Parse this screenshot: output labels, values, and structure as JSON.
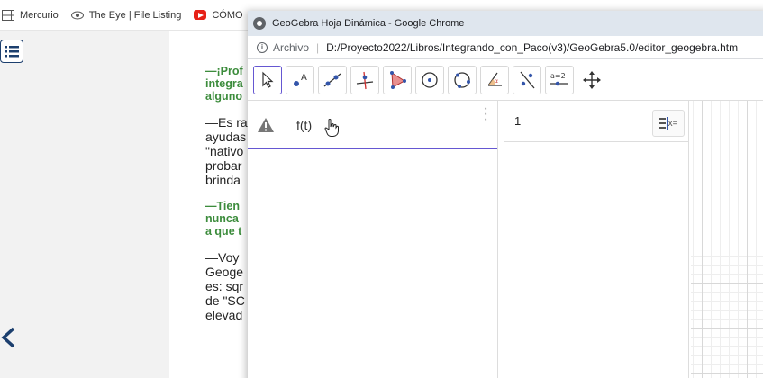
{
  "bookmarks": [
    {
      "label": "Mercurio",
      "icon": "film-icon"
    },
    {
      "label": "The Eye | File Listing",
      "icon": "eye-icon"
    },
    {
      "label": "CÓMO",
      "icon": "youtube-icon"
    }
  ],
  "background_page": {
    "paragraphs": [
      {
        "style": "green",
        "lines": [
          "—¡Prof",
          "integra",
          "alguno"
        ]
      },
      {
        "style": "normal",
        "lines": [
          "—Es ra",
          "ayudas",
          "\"nativo",
          "probar",
          "brinda"
        ]
      },
      {
        "style": "green",
        "lines": [
          "—Tien",
          "nunca ",
          "a que t"
        ]
      },
      {
        "style": "normal",
        "lines": [
          "—Voy ",
          "Geoge",
          "es: sqr",
          "de \"SC",
          "elevad"
        ]
      }
    ]
  },
  "window": {
    "title": "GeoGebra Hoja Dinámica - Google Chrome",
    "address": {
      "scheme": "Archivo",
      "url": "D:/Proyecto2022/Libros/Integrando_con_Paco(v3)/GeoGebra5.0/editor_geogebra.htm"
    }
  },
  "toolbar": {
    "tools": [
      {
        "name": "move-tool-icon",
        "active": true
      },
      {
        "name": "point-tool-icon"
      },
      {
        "name": "line-tool-icon"
      },
      {
        "name": "perpendicular-line-tool-icon"
      },
      {
        "name": "polygon-tool-icon"
      },
      {
        "name": "circle-tool-icon"
      },
      {
        "name": "circle-three-points-tool-icon"
      },
      {
        "name": "angle-tool-icon"
      },
      {
        "name": "reflect-tool-icon"
      },
      {
        "name": "slider-tool-icon",
        "text": "a=2"
      },
      {
        "name": "move-graphics-tool-icon"
      }
    ]
  },
  "algebra": {
    "input_text": "f(t)"
  },
  "view2": {
    "row1_value": "1",
    "button_label": "x="
  },
  "colors": {
    "accent": "#6557d2",
    "navy": "#1c3f6e",
    "green_text": "#3c8c3c",
    "title_bar": "#dfe6ee"
  }
}
